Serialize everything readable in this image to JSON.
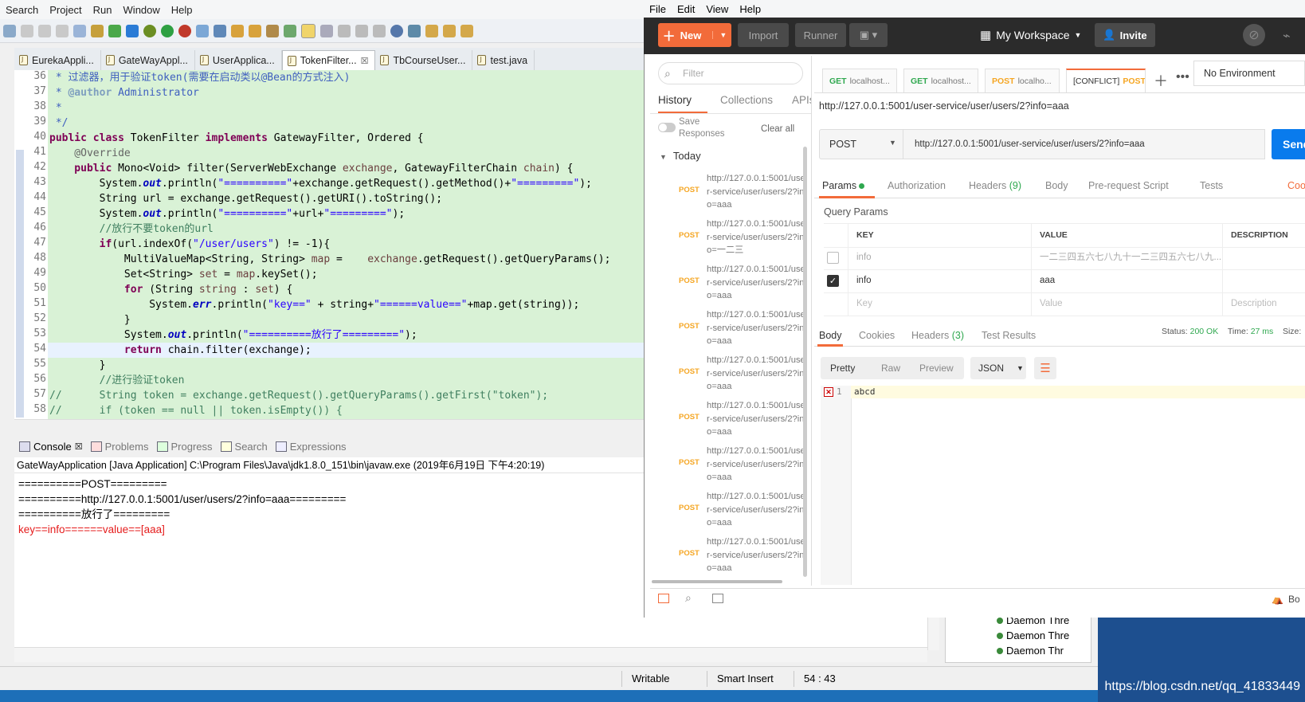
{
  "eclipse": {
    "menu": [
      "Search",
      "Project",
      "Run",
      "Window",
      "Help"
    ],
    "tabs": [
      "EurekaAppli...",
      "GateWayAppl...",
      "UserApplica...",
      "TokenFilter...",
      "TbCourseUser...",
      "test.java"
    ],
    "active_tab_close": "☒",
    "code": {
      "lines": [
        "36",
        "37",
        "38",
        "39",
        "40",
        "41",
        "42",
        "43",
        "44",
        "45",
        "46",
        "47",
        "48",
        "49",
        "50",
        "51",
        "52",
        "53",
        "54",
        "55",
        "56",
        "57",
        "58"
      ],
      "l36": " * 过滤器，用于验证token(需要在启动类以@Bean的方式注入)",
      "l37a": " * ",
      "l37b": "@author",
      "l37c": " Administrator",
      "l38": " *",
      "l39": " */",
      "l40a": "public class",
      "l40b": " TokenFilter ",
      "l40c": "implements",
      "l40d": " GatewayFilter, Ordered {",
      "l41": "    @Override",
      "l42a": "    public",
      "l42b": " Mono<Void> filter(ServerWebExchange ",
      "l42c": "exchange",
      "l42d": ", GatewayFilterChain ",
      "l42e": "chain",
      "l42f": ") {",
      "l43a": "        System.",
      "l43b": "out",
      "l43c": ".println(",
      "l43d": "\"==========\"",
      "l43e": "+exchange.getRequest().getMethod()+",
      "l43f": "\"=========\"",
      "l43g": ");",
      "l44": "        String url = exchange.getRequest().getURI().toString();",
      "l45a": "        System.",
      "l45b": "out",
      "l45c": ".println(",
      "l45d": "\"==========\"",
      "l45e": "+url+",
      "l45f": "\"=========\"",
      "l45g": ");",
      "l46": "        //放行不要token的url",
      "l47a": "        if",
      "l47b": "(url.indexOf(",
      "l47c": "\"/user/users\"",
      "l47d": ") != -1){",
      "l48a": "            MultiValueMap<String, String> ",
      "l48b": "map",
      "l48c": " =    ",
      "l48d": "exchange",
      "l48e": ".getRequest().getQueryParams();",
      "l49a": "            Set<String> ",
      "l49b": "set",
      "l49c": " = ",
      "l49d": "map",
      "l49e": ".keySet();",
      "l50a": "            for",
      "l50b": " (String ",
      "l50c": "string",
      "l50d": " : ",
      "l50e": "set",
      "l50f": ") {",
      "l51a": "                System.",
      "l51b": "err",
      "l51c": ".println(",
      "l51d": "\"key==\"",
      "l51e": " + string+",
      "l51f": "\"======value==\"",
      "l51g": "+map.get(string));",
      "l52": "            }",
      "l53a": "            System.",
      "l53b": "out",
      "l53c": ".println(",
      "l53d": "\"==========放行了=========\"",
      "l53e": ");",
      "l54a": "            return",
      "l54b": " chain.filter(exchange);",
      "l55": "        }",
      "l56": "        //进行验证token",
      "l57": "//      String token = exchange.getRequest().getQueryParams().getFirst(\"token\");",
      "l58": "//      if (token == null || token.isEmpty()) {"
    },
    "console_tabs": [
      "Console",
      "Problems",
      "Progress",
      "Search",
      "Expressions"
    ],
    "console_header": "GateWayApplication [Java Application] C:\\Program Files\\Java\\jdk1.8.0_151\\bin\\javaw.exe (2019年6月19日 下午4:20:19)",
    "console_lines": [
      "==========POST=========",
      "==========http://127.0.0.1:5001/user/users/2?info=aaa=========",
      "==========放行了========="
    ],
    "console_err": "key==info======value==[aaa]",
    "outline_items": [
      "Daemon Thre",
      "Daemon Thre",
      "Daemon Thr"
    ],
    "status": {
      "writable": "Writable",
      "insert": "Smart Insert",
      "position": "54 : 43"
    },
    "watermark": "https://blog.csdn.net/qq_41833449"
  },
  "postman": {
    "menu": [
      "File",
      "Edit",
      "View",
      "Help"
    ],
    "new_label": "New",
    "import_label": "Import",
    "runner_label": "Runner",
    "workspace": "My Workspace",
    "invite": "Invite",
    "filter_placeholder": "Filter",
    "side_tabs": [
      "History",
      "Collections",
      "APIs"
    ],
    "save_responses": "Save Responses",
    "clear_all": "Clear all",
    "today": "Today",
    "history": [
      {
        "method": "POST",
        "url": "http://127.0.0.1:5001/user-service/user/users/2?info=aaa"
      },
      {
        "method": "POST",
        "url": "http://127.0.0.1:5001/user-service/user/users/2?info=一二三"
      },
      {
        "method": "POST",
        "url": "http://127.0.0.1:5001/user-service/user/users/2?info=aaa"
      },
      {
        "method": "POST",
        "url": "http://127.0.0.1:5001/user-service/user/users/2?info=aaa"
      },
      {
        "method": "POST",
        "url": "http://127.0.0.1:5001/user-service/user/users/2?info=aaa"
      },
      {
        "method": "POST",
        "url": "http://127.0.0.1:5001/user-service/user/users/2?info=aaa"
      },
      {
        "method": "POST",
        "url": "http://127.0.0.1:5001/user-service/user/users/2?info=aaa"
      },
      {
        "method": "POST",
        "url": "http://127.0.0.1:5001/user-service/user/users/2?info=aaa"
      },
      {
        "method": "POST",
        "url": "http://127.0.0.1:5001/user-service/user/users/2?info=aaa"
      }
    ],
    "req_tabs": [
      {
        "method": "GET",
        "label": "localhost..."
      },
      {
        "method": "GET",
        "label": "localhost..."
      },
      {
        "method": "POST",
        "label": "localho..."
      },
      {
        "method": "POST",
        "label": "[CONFLICT]"
      }
    ],
    "environment": "No Environment",
    "request_title": "http://127.0.0.1:5001/user-service/user/users/2?info=aaa",
    "method": "POST",
    "url": "http://127.0.0.1:5001/user-service/user/users/2?info=aaa",
    "send": "Send",
    "req_subtabs": {
      "params": "Params",
      "auth": "Authorization",
      "headers": "Headers",
      "headers_count": "(9)",
      "body": "Body",
      "pre": "Pre-request Script",
      "tests": "Tests",
      "cookies": "Cookies"
    },
    "query_params_title": "Query Params",
    "table_headers": [
      "KEY",
      "VALUE",
      "DESCRIPTION"
    ],
    "params": [
      {
        "checked": false,
        "key": "info",
        "value": "一二三四五六七八九十一二三四五六七八九..."
      },
      {
        "checked": true,
        "key": "info",
        "value": "aaa"
      }
    ],
    "param_placeholders": {
      "key": "Key",
      "value": "Value",
      "description": "Description"
    },
    "resp_tabs": {
      "body": "Body",
      "cookies": "Cookies",
      "headers": "Headers",
      "headers_count": "(3)",
      "tests": "Test Results"
    },
    "status_label": "Status:",
    "status_value": "200 OK",
    "time_label": "Time:",
    "time_value": "27 ms",
    "size_label": "Size:",
    "formats": [
      "Pretty",
      "Raw",
      "Preview"
    ],
    "format_type": "JSON",
    "response_line": "1",
    "response_text": "abcd",
    "bootcamp": "Bootcamp"
  }
}
